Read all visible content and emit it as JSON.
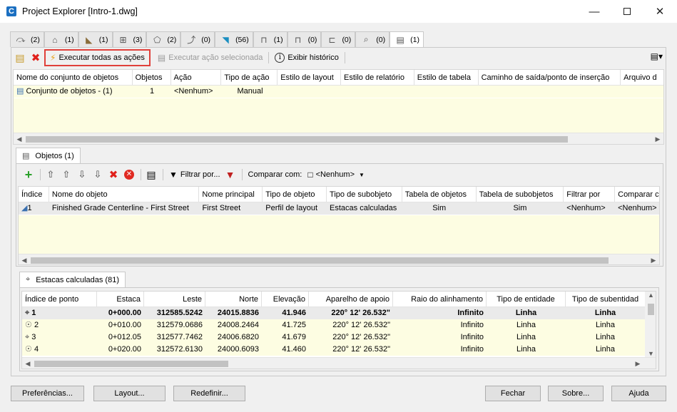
{
  "window": {
    "title": "Project Explorer [Intro-1.dwg]",
    "app_icon": "C"
  },
  "top_tabs": [
    {
      "icon": "alignment-icon",
      "glyph": "⤼",
      "count": "(2)"
    },
    {
      "icon": "building-icon",
      "glyph": "⌂",
      "count": "(1)"
    },
    {
      "icon": "profile-icon",
      "glyph": "◣",
      "count": "(1)"
    },
    {
      "icon": "corridor-icon",
      "glyph": "⊞",
      "count": "(3)"
    },
    {
      "icon": "surface-icon",
      "glyph": "⬠",
      "count": "(2)"
    },
    {
      "icon": "feature-line-icon",
      "glyph": "⤴",
      "count": "(0)"
    },
    {
      "icon": "point-icon",
      "glyph": "◥",
      "count": "(56)"
    },
    {
      "icon": "pipe-network-icon",
      "glyph": "⊓",
      "count": "(1)"
    },
    {
      "icon": "pressure-network-icon",
      "glyph": "⊓",
      "count": "(0)"
    },
    {
      "icon": "section-icon",
      "glyph": "⊏",
      "count": "(0)"
    },
    {
      "icon": "view-icon",
      "glyph": "⌕",
      "count": "(0)"
    },
    {
      "icon": "object-set-icon",
      "glyph": "▤",
      "count": "(1)"
    }
  ],
  "toolbar1": {
    "run_all": "Executar todas as ações",
    "run_selected": "Executar ação selecionada",
    "history": "Exibir histórico"
  },
  "sets_grid": {
    "columns": [
      "Nome do conjunto de objetos",
      "Objetos",
      "Ação",
      "Tipo de ação",
      "Estilo de layout",
      "Estilo de relatório",
      "Estilo de tabela",
      "Caminho de saída/ponto de inserção",
      "Arquivo d"
    ],
    "rows": [
      {
        "name": "Conjunto de objetos - (1)",
        "objects": "1",
        "action": "<Nenhum>",
        "action_type": "Manual"
      }
    ]
  },
  "objects_tab": {
    "label": "Objetos (1)"
  },
  "toolbar2": {
    "filter": "Filtrar por...",
    "compare_label": "Comparar com:",
    "compare_value": "<Nenhum>"
  },
  "objects_grid": {
    "columns": [
      "Índice",
      "Nome do objeto",
      "Nome principal",
      "Tipo de objeto",
      "Tipo de subobjeto",
      "Tabela de objetos",
      "Tabela de subobjetos",
      "Filtrar por",
      "Comparar c"
    ],
    "rows": [
      {
        "index": "1",
        "name": "Finished Grade Centerline - First Street",
        "parent": "First Street",
        "type": "Perfil de layout",
        "subtype": "Estacas calculadas",
        "obj_table": "Sim",
        "sub_table": "Sim",
        "filter": "<Nenhum>",
        "compare": "<Nenhum>"
      }
    ]
  },
  "stations_tab": {
    "label": "Estacas calculadas (81)"
  },
  "stations_grid": {
    "columns": [
      "Índice de ponto",
      "Estaca",
      "Leste",
      "Norte",
      "Elevação",
      "Aparelho de apoio",
      "Raio do alinhamento",
      "Tipo de entidade",
      "Tipo de subentidad"
    ],
    "rows": [
      {
        "index": "1",
        "station": "0+000.00",
        "east": "312585.5242",
        "north": "24015.8836",
        "elev": "41.946",
        "bearing": "220° 12' 26.532\"",
        "radius": "Infinito",
        "entity": "Linha",
        "subentity": "Linha"
      },
      {
        "index": "2",
        "station": "0+010.00",
        "east": "312579.0686",
        "north": "24008.2464",
        "elev": "41.725",
        "bearing": "220° 12' 26.532\"",
        "radius": "Infinito",
        "entity": "Linha",
        "subentity": "Linha"
      },
      {
        "index": "3",
        "station": "0+012.05",
        "east": "312577.7462",
        "north": "24006.6820",
        "elev": "41.679",
        "bearing": "220° 12' 26.532\"",
        "radius": "Infinito",
        "entity": "Linha",
        "subentity": "Linha"
      },
      {
        "index": "4",
        "station": "0+020.00",
        "east": "312572.6130",
        "north": "24000.6093",
        "elev": "41.460",
        "bearing": "220° 12' 26.532\"",
        "radius": "Infinito",
        "entity": "Linha",
        "subentity": "Linha"
      }
    ]
  },
  "buttons": {
    "preferences": "Preferências...",
    "layout": "Layout...",
    "reset": "Redefinir...",
    "close": "Fechar",
    "about": "Sobre...",
    "help": "Ajuda"
  },
  "colors": {
    "highlight": "#e0403a",
    "row_fill": "#fdfde2",
    "accent": "#1b6fc1"
  }
}
